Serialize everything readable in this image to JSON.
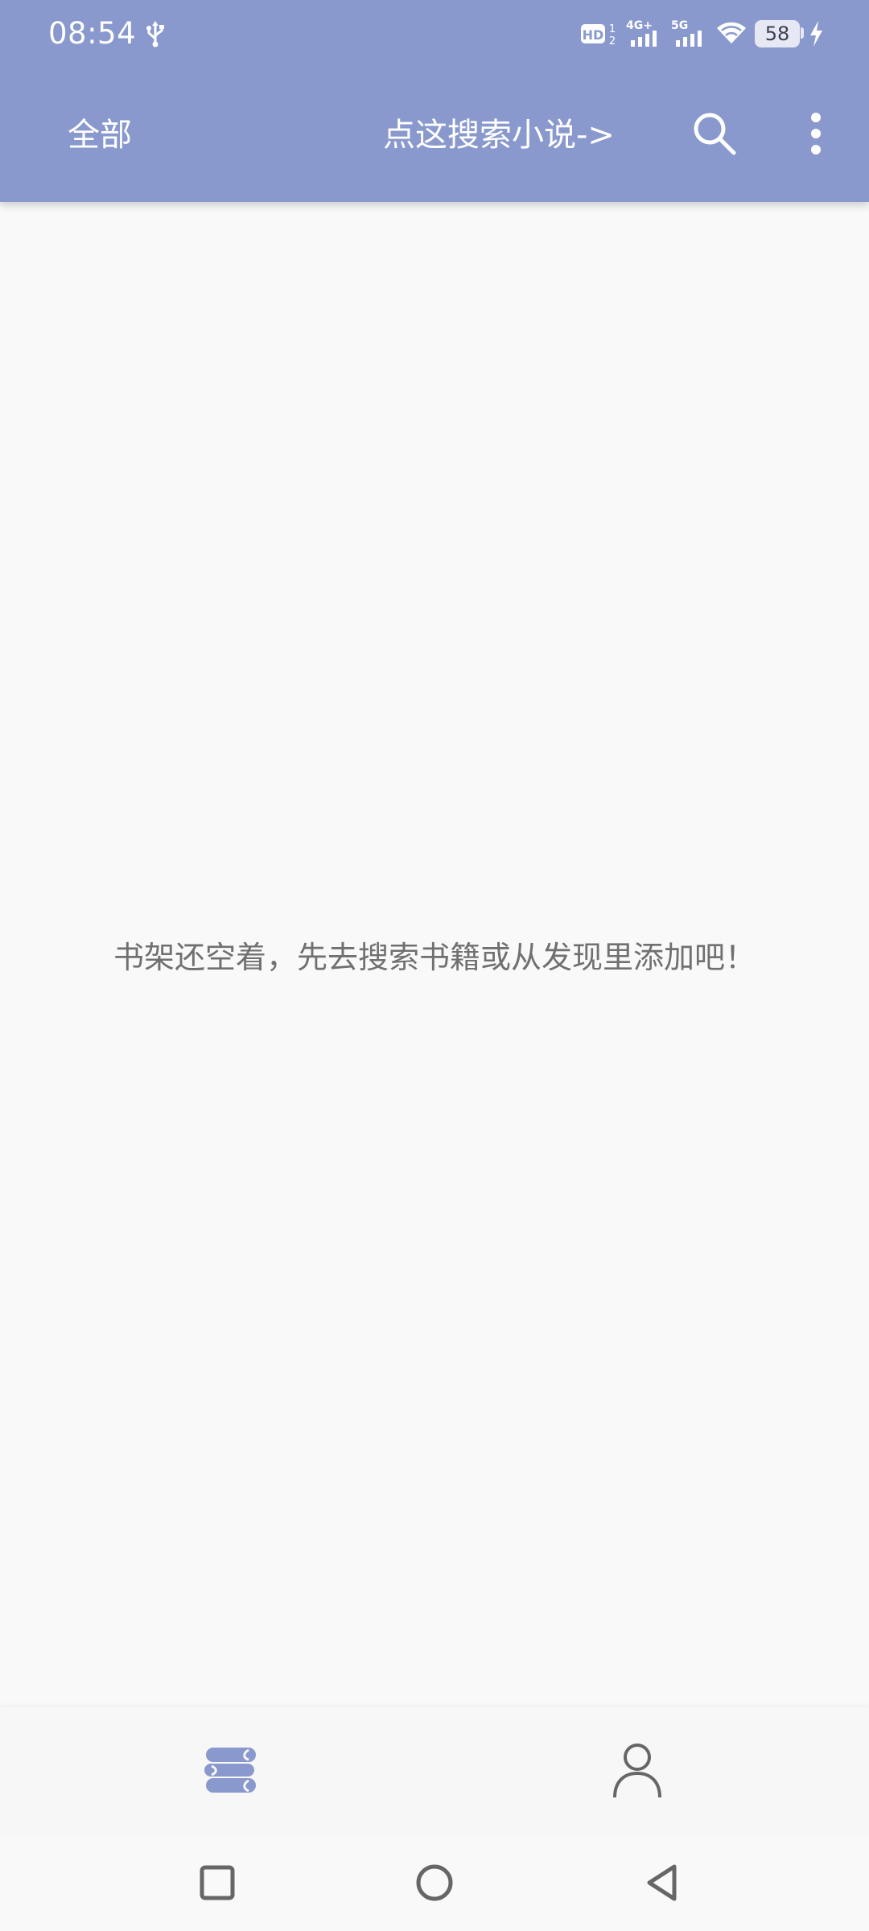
{
  "status_bar": {
    "time": "08:54",
    "battery": "58",
    "icons": [
      "usb-icon",
      "hd-voice-icon",
      "signal-4g-icon",
      "signal-5g-icon",
      "wifi-icon",
      "battery-icon",
      "charging-bolt-icon"
    ]
  },
  "app_bar": {
    "group_label": "全部",
    "search_hint": "点这搜索小说->",
    "icons": [
      "search-icon",
      "more-vertical-icon"
    ]
  },
  "main": {
    "empty_message": "书架还空着，先去搜索书籍或从发现里添加吧！"
  },
  "bottom_nav": {
    "items": [
      {
        "icon": "bookshelf-icon",
        "active": true
      },
      {
        "icon": "profile-icon",
        "active": false
      }
    ]
  },
  "system_nav": {
    "icons": [
      "recent-apps-icon",
      "home-icon",
      "back-icon"
    ]
  },
  "colors": {
    "primary": "#8a99cd",
    "background": "#f9f9f9",
    "empty_text": "#707070",
    "nav_active": "#8a99cd",
    "nav_inactive": "#666666"
  }
}
